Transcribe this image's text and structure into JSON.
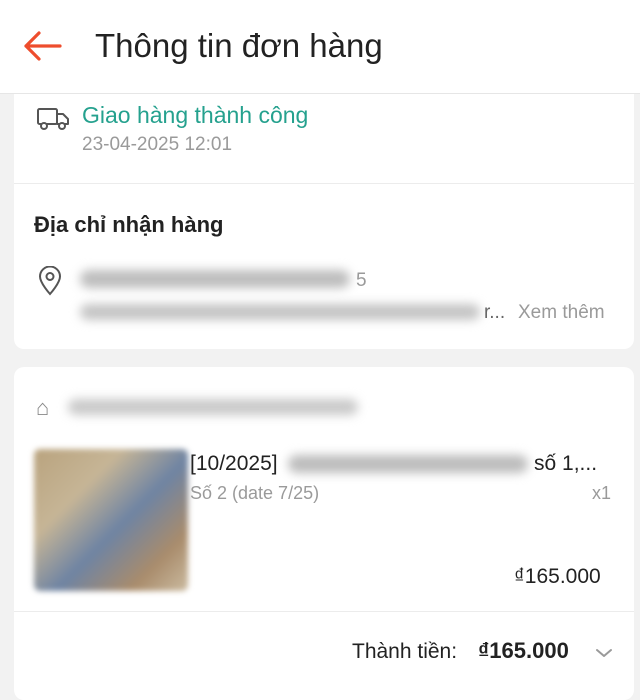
{
  "header": {
    "title": "Thông tin đơn hàng",
    "back_icon": "arrow-left-icon",
    "accent": "#ee4d2d"
  },
  "shipping": {
    "status": "Giao hàng thành công",
    "time": "23-04-2025 12:01",
    "status_color": "#25a18e"
  },
  "address": {
    "label": "Địa chỉ nhận hàng",
    "line1_end": "5",
    "line2_end": "r...",
    "see_more": "Xem thêm"
  },
  "order": {
    "product_title_start": "[10/2025]",
    "product_title_end": "số 1,...",
    "variant": "Số 2 (date 7/25)",
    "quantity": "x1",
    "price": "₫165.000",
    "total_label": "Thành tiền:",
    "total_value": "₫165.000"
  }
}
